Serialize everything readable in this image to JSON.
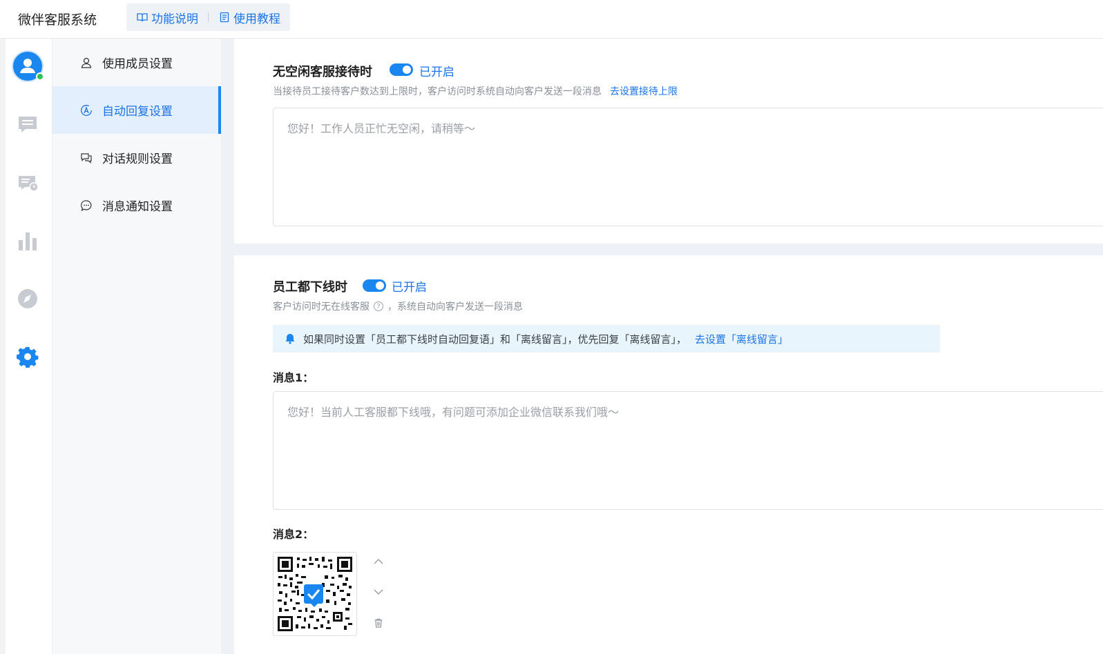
{
  "header": {
    "app_title": "微伴客服系统",
    "links": [
      {
        "label": "功能说明",
        "icon": "book-open-icon"
      },
      {
        "label": "使用教程",
        "icon": "document-icon"
      }
    ]
  },
  "rail": {
    "items": [
      "avatar",
      "chat-icon",
      "chat-history-icon",
      "bar-chart-icon",
      "compass-icon",
      "settings-gear-icon"
    ],
    "active_color": "#1a86f0",
    "online_color": "#2fc25b"
  },
  "subnav": {
    "items": [
      {
        "label": "使用成员设置",
        "icon": "user-icon"
      },
      {
        "label": "自动回复设置",
        "icon": "auto-reply-icon",
        "active": true
      },
      {
        "label": "对话规则设置",
        "icon": "dialog-rules-icon"
      },
      {
        "label": "消息通知设置",
        "icon": "message-bubble-icon"
      }
    ]
  },
  "busy_section": {
    "title": "无空闲客服接待时",
    "toggle_label": "已开启",
    "hint": "当接待员工接待客户数达到上限时，客户访问时系统自动向客户发送一段消息",
    "hint_link": "去设置接待上限",
    "placeholder": "您好！工作人员正忙无空闲，请稍等～"
  },
  "offline_section": {
    "title": "员工都下线时",
    "toggle_label": "已开启",
    "hint_prefix": "客户访问时无在线客服",
    "hint_suffix": "，系统自动向客户发送一段消息",
    "notice": "如果同时设置「员工都下线时自动回复语」和「离线留言」，优先回复「离线留言」，",
    "notice_link": "去设置「离线留言」",
    "msg1_label": "消息1：",
    "msg1_placeholder": "您好！当前人工客服都下线哦，有问题可添加企业微信联系我们哦～",
    "msg2_label": "消息2："
  }
}
